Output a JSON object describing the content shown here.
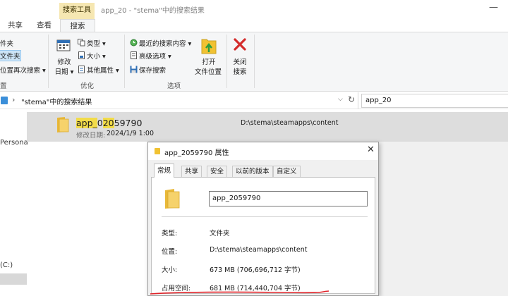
{
  "window": {
    "contextual_tab": "搜索工具",
    "title": "app_20 - \"stema\"中的搜索结果",
    "minimize_label": "—"
  },
  "ribbon": {
    "tabs": {
      "share": "共享",
      "view": "查看",
      "search": "搜索"
    },
    "location_group": {
      "current_folder": "件夹",
      "subfolders": "文件夹",
      "search_again": "位置再次搜索 ▾",
      "label": "置"
    },
    "refine_group": {
      "date_modified": "修改\n日期 ▾",
      "date_line1": "修改",
      "date_line2": "日期 ▾",
      "kind": "类型 ▾",
      "size": "大小 ▾",
      "other_props": "其他属性 ▾",
      "label": "优化"
    },
    "options_group": {
      "recent": "最近的搜索内容 ▾",
      "advanced": "高级选项 ▾",
      "save": "保存搜索",
      "open_line1": "打开",
      "open_line2": "文件位置",
      "label": "选项"
    },
    "close_group": {
      "close_line1": "关闭",
      "close_line2": "搜索"
    }
  },
  "address": {
    "chevron": "›",
    "path": "\"stema\"中的搜索结果",
    "dropdown": "⌵",
    "refresh": "↻",
    "search_value": "app_20"
  },
  "nav": {
    "personal": "Persona",
    "drive": "(C:)"
  },
  "result": {
    "name_highlight_1": "app_",
    "name_highlight_2": "20",
    "name_rest": "59790",
    "date_label": "修改日期:",
    "date_value": "2024/1/9 1:00",
    "path": "D:\\stema\\steamapps\\content"
  },
  "dialog": {
    "title": "app_2059790 属性",
    "close": "✕",
    "tabs": [
      "常规",
      "共享",
      "安全",
      "以前的版本",
      "自定义"
    ],
    "name_value": "app_2059790",
    "props": [
      {
        "label": "类型:",
        "value": "文件夹"
      },
      {
        "label": "位置:",
        "value": "D:\\stema\\steamapps\\content"
      },
      {
        "label": "大小:",
        "value": "673 MB (706,696,712 字节)"
      },
      {
        "label": "占用空间:",
        "value": "681 MB (714,440,704 字节)"
      }
    ]
  },
  "colors": {
    "contextual_tab": "#f6e7b2",
    "highlight": "#f2dc4a",
    "annotation": "#e0242a",
    "close_x": "#d42b2b",
    "folder": "#f1c232"
  }
}
